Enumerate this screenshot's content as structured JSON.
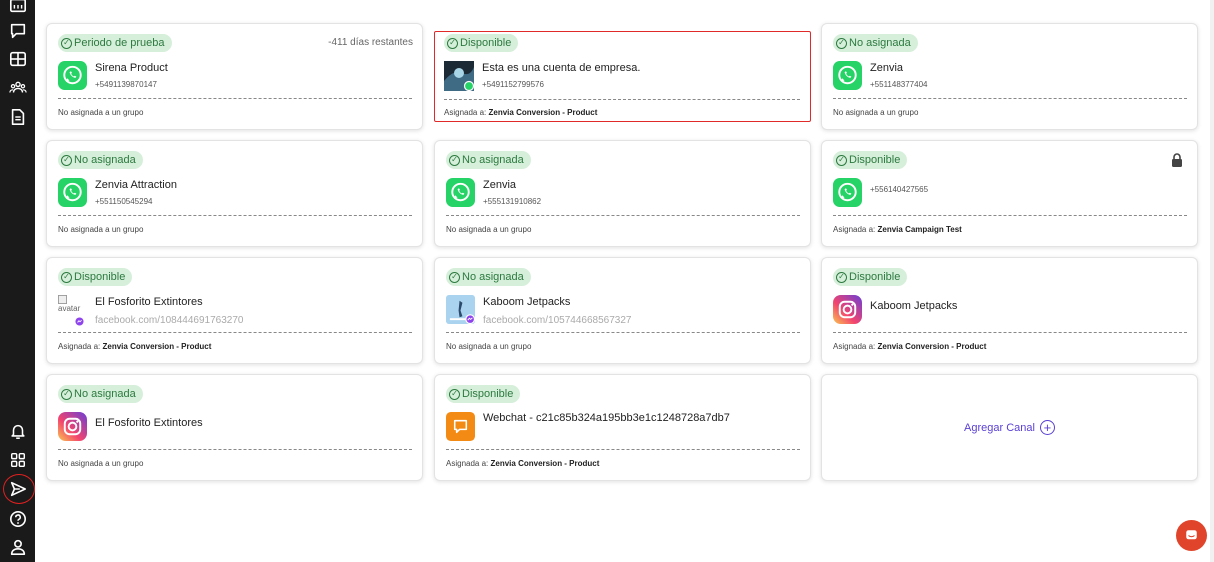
{
  "channels": [
    {
      "status": "Periodo de prueba",
      "days": "-411 días restantes",
      "name": "Sirena Product",
      "sub": "+5491139870147",
      "group_label": "No asignada a un grupo",
      "group_name": ""
    },
    {
      "status": "Disponible",
      "name": "Esta es una cuenta de empresa.",
      "sub": "+5491152799576",
      "group_label": "Asignada a:",
      "group_name": "Zenvia Conversion - Product"
    },
    {
      "status": "No asignada",
      "name": "Zenvia",
      "sub": "+551148377404",
      "group_label": "No asignada a un grupo",
      "group_name": ""
    },
    {
      "status": "No asignada",
      "name": "Zenvia Attraction",
      "sub": "+551150545294",
      "group_label": "No asignada a un grupo",
      "group_name": ""
    },
    {
      "status": "No asignada",
      "name": "Zenvia",
      "sub": "+555131910862",
      "group_label": "No asignada a un grupo",
      "group_name": ""
    },
    {
      "status": "Disponible",
      "name": "",
      "sub": "+556140427565",
      "group_label": "Asignada a:",
      "group_name": "Zenvia Campaign Test"
    },
    {
      "status": "Disponible",
      "avatar_alt": "avatar",
      "name": "El Fosforito Extintores",
      "sub": "facebook.com/108444691763270",
      "group_label": "Asignada a:",
      "group_name": "Zenvia Conversion - Product"
    },
    {
      "status": "No asignada",
      "name": "Kaboom Jetpacks",
      "sub": "facebook.com/105744668567327",
      "group_label": "No asignada a un grupo",
      "group_name": ""
    },
    {
      "status": "Disponible",
      "name": "Kaboom Jetpacks",
      "sub": "",
      "group_label": "Asignada a:",
      "group_name": "Zenvia Conversion - Product"
    },
    {
      "status": "No asignada",
      "name": "El Fosforito Extintores",
      "sub": "",
      "group_label": "No asignada a un grupo",
      "group_name": ""
    },
    {
      "status": "Disponible",
      "name": "Webchat - c21c85b324a195bb3e1c1248728a7db7",
      "sub": "",
      "group_label": "Asignada a:",
      "group_name": "Zenvia Conversion - Product"
    }
  ],
  "add_channel_label": "Agregar Canal",
  "colors": {
    "whatsapp": "#25d366",
    "badge_bg": "#d6efda",
    "badge_text": "#2c7a3f",
    "accent": "#5a3fd4",
    "selected_border": "#e02a2a",
    "sidebar": "#1a1a1a",
    "chat_button": "#e0452c",
    "webchat": "#f28a13"
  },
  "sidebar_icons": [
    "calendar-icon",
    "chat-icon",
    "table-icon",
    "team-icon",
    "document-icon",
    "bell-icon",
    "apps-icon",
    "send-icon",
    "help-icon",
    "user-icon"
  ]
}
